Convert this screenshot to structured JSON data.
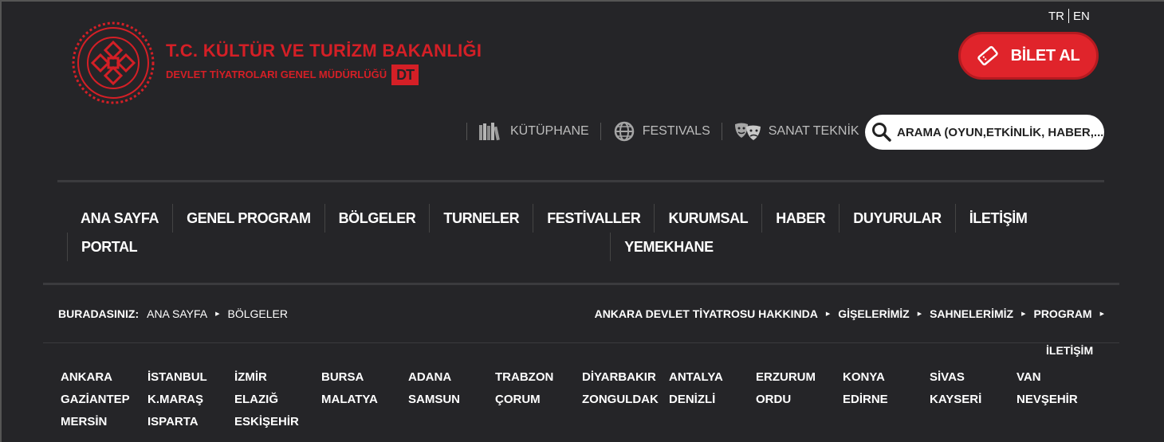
{
  "logo": {
    "title": "T.C. KÜLTÜR VE TURİZM BAKANLIĞI",
    "subtitle": "DEVLET TİYATROLARI GENEL MÜDÜRLÜĞÜ",
    "badge": "DT",
    "color": "#d41f26"
  },
  "lang": {
    "tr": "TR",
    "en": "EN"
  },
  "ticket": {
    "label": "BİLET AL",
    "icon": "ticket-icon",
    "color": "#e0242b"
  },
  "util": [
    {
      "label": "KÜTÜPHANE",
      "icon": "books-icon"
    },
    {
      "label": "FESTIVALS",
      "icon": "globe-icon"
    },
    {
      "label": "SANAT TEKNİK",
      "icon": "theater-masks-icon"
    }
  ],
  "search": {
    "placeholder": "ARAMA (OYUN,ETKİNLİK, HABER,...",
    "icon": "search-icon"
  },
  "mainnav": [
    "ANA SAYFA",
    "GENEL PROGRAM",
    "BÖLGELER",
    "TURNELER",
    "FESTİVALLER",
    "KURUMSAL",
    "HABER",
    "DUYURULAR",
    "İLETİŞİM",
    "PORTAL",
    "YEMEKHANE"
  ],
  "breadcrumb": {
    "label": "BURADASINIZ:",
    "items": [
      "ANA SAYFA",
      "BÖLGELER"
    ]
  },
  "subnav": [
    "ANKARA DEVLET TİYATROSU HAKKINDA",
    "GİŞELERİMİZ",
    "SAHNELERİMİZ",
    "PROGRAM"
  ],
  "contact": "İLETİŞİM",
  "cities": [
    "ANKARA",
    "İSTANBUL",
    "İZMİR",
    "BURSA",
    "ADANA",
    "TRABZON",
    "DİYARBAKIR",
    "ANTALYA",
    "ERZURUM",
    "KONYA",
    "SİVAS",
    "VAN",
    "GAZİANTEP",
    "K.MARAŞ",
    "ELAZIĞ",
    "MALATYA",
    "SAMSUN",
    "ÇORUM",
    "ZONGULDAK",
    "DENİZLİ",
    "ORDU",
    "EDİRNE",
    "KAYSERİ",
    "NEVŞEHİR",
    "MERSİN",
    "ISPARTA",
    "ESKİŞEHİR"
  ]
}
